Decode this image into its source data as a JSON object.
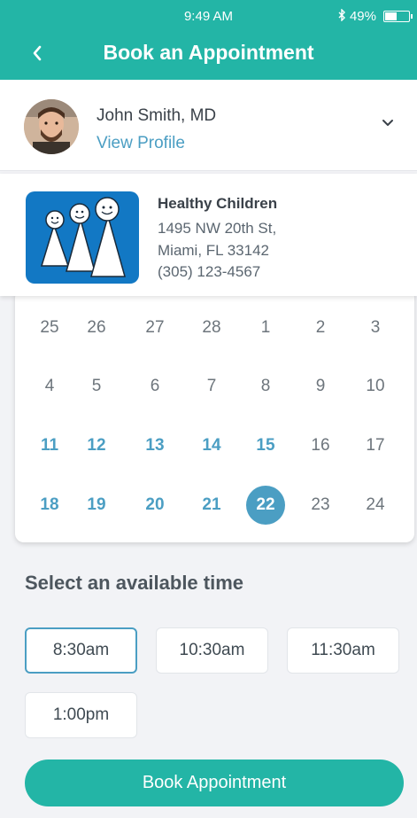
{
  "status_bar": {
    "time": "9:49 AM",
    "battery": "49%",
    "bluetooth_icon": "bluetooth-icon",
    "battery_icon": "battery-icon"
  },
  "nav": {
    "title": "Book an Appointment",
    "back_icon": "chevron-left-icon"
  },
  "doctor": {
    "name": "John Smith, MD",
    "view_profile": "View Profile",
    "expand_icon": "chevron-down-icon"
  },
  "clinic": {
    "name": "Healthy Children",
    "address_line1": "1495 NW 20th St,",
    "address_line2": "Miami, FL 33142",
    "phone": "(305) 123-4567",
    "logo": "healthy-children-logo"
  },
  "calendar": {
    "weeks": [
      [
        {
          "d": "25",
          "s": "unavailable"
        },
        {
          "d": "26",
          "s": "unavailable"
        },
        {
          "d": "27",
          "s": "unavailable"
        },
        {
          "d": "28",
          "s": "unavailable"
        },
        {
          "d": "1",
          "s": "unavailable"
        },
        {
          "d": "2",
          "s": "unavailable"
        },
        {
          "d": "3",
          "s": "unavailable"
        }
      ],
      [
        {
          "d": "4",
          "s": "unavailable"
        },
        {
          "d": "5",
          "s": "unavailable"
        },
        {
          "d": "6",
          "s": "unavailable"
        },
        {
          "d": "7",
          "s": "unavailable"
        },
        {
          "d": "8",
          "s": "unavailable"
        },
        {
          "d": "9",
          "s": "unavailable"
        },
        {
          "d": "10",
          "s": "unavailable"
        }
      ],
      [
        {
          "d": "11",
          "s": "available"
        },
        {
          "d": "12",
          "s": "available"
        },
        {
          "d": "13",
          "s": "available"
        },
        {
          "d": "14",
          "s": "available"
        },
        {
          "d": "15",
          "s": "available"
        },
        {
          "d": "16",
          "s": "unavailable"
        },
        {
          "d": "17",
          "s": "unavailable"
        }
      ],
      [
        {
          "d": "18",
          "s": "available"
        },
        {
          "d": "19",
          "s": "available"
        },
        {
          "d": "20",
          "s": "available"
        },
        {
          "d": "21",
          "s": "available"
        },
        {
          "d": "22",
          "s": "selected"
        },
        {
          "d": "23",
          "s": "unavailable"
        },
        {
          "d": "24",
          "s": "unavailable"
        }
      ]
    ]
  },
  "times": {
    "title": "Select an available time",
    "slots": [
      {
        "label": "8:30am",
        "selected": true
      },
      {
        "label": "10:30am",
        "selected": false
      },
      {
        "label": "11:30am",
        "selected": false
      },
      {
        "label": "1:00pm",
        "selected": false
      }
    ]
  },
  "book_button": {
    "label": "Book Appointment"
  },
  "colors": {
    "brand_teal": "#23b5a6",
    "accent_blue": "#4b9ec3",
    "logo_blue": "#1278c4"
  }
}
